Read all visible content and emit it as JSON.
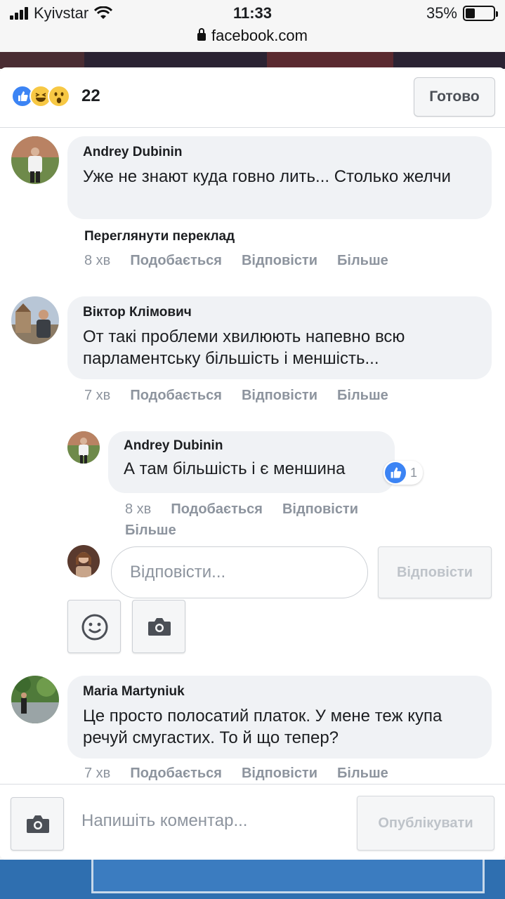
{
  "status_bar": {
    "carrier": "Kyivstar",
    "time": "11:33",
    "battery": "35%",
    "battery_level": 0.35
  },
  "browser": {
    "url": "facebook.com"
  },
  "header": {
    "reaction_icons": [
      "like-icon",
      "haha-icon",
      "wow-icon"
    ],
    "reaction_count": "22",
    "done_label": "Готово"
  },
  "comments": [
    {
      "author": "Andrey Dubinin",
      "text": "Уже не знают куда говно лить... Столько желчи",
      "translate": "Переглянути переклад",
      "time": "8 хв",
      "like": "Подобається",
      "reply": "Відповісти",
      "more": "Більше"
    },
    {
      "author": "Віктор Клімович",
      "text": "От такі проблеми хвилюють напевно всю парламентську більшість і меншість...",
      "time": "7 хв",
      "like": "Подобається",
      "reply": "Відповісти",
      "more": "Більше"
    },
    {
      "author": "Andrey Dubinin",
      "text": "А там більшість і є меншина",
      "reaction_count": "1",
      "time": "8 хв",
      "like": "Подобається",
      "reply": "Відповісти",
      "more": "Більше"
    },
    {
      "author": "Maria Martyniuk",
      "text": "Це просто полосатий платок. У мене теж купа речуй смугастих. То й що тепер?",
      "time": "7 хв",
      "like": "Подобається",
      "reply": "Відповісти",
      "more": "Більше"
    }
  ],
  "reply_box": {
    "placeholder": "Відповісти...",
    "button": "Відповісти"
  },
  "composer": {
    "placeholder": "Напишіть коментар...",
    "publish": "Опублікувати"
  },
  "colors": {
    "accent": "#3c84f4",
    "bubble": "#f0f2f5",
    "muted": "#8d949e"
  }
}
